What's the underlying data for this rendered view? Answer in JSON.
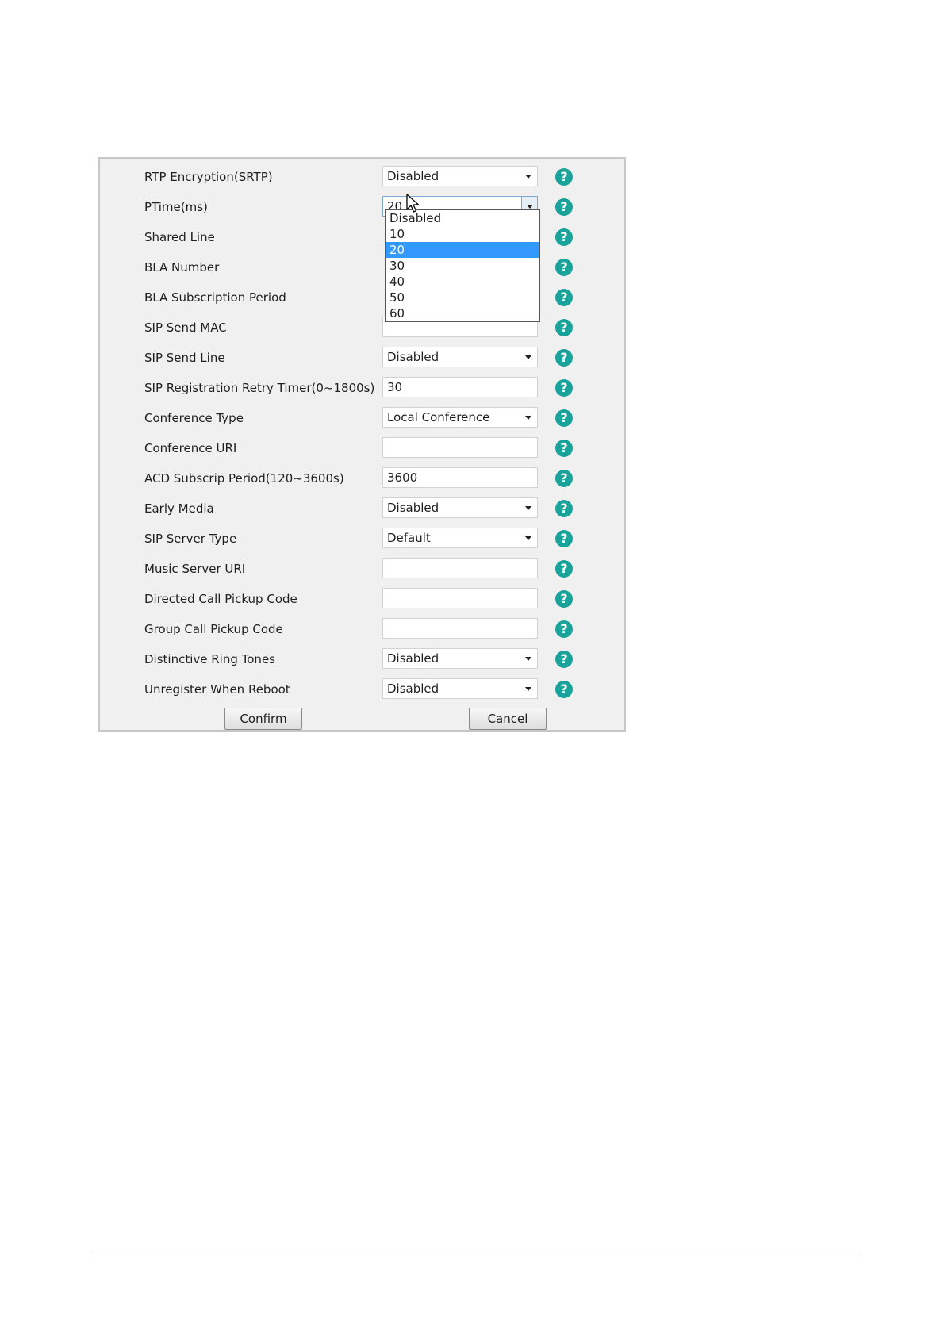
{
  "rows": [
    {
      "label": "RTP Encryption(SRTP)",
      "value": "Disabled"
    },
    {
      "label": "PTime(ms)",
      "value": "20"
    },
    {
      "label": "Shared Line",
      "value": ""
    },
    {
      "label": "BLA Number",
      "value": ""
    },
    {
      "label": "BLA Subscription Period",
      "value": ""
    },
    {
      "label": "SIP Send MAC",
      "value": ""
    },
    {
      "label": "SIP Send Line",
      "value": "Disabled"
    },
    {
      "label": "SIP Registration Retry Timer(0~1800s)",
      "value": "30"
    },
    {
      "label": "Conference Type",
      "value": "Local Conference"
    },
    {
      "label": "Conference URI",
      "value": ""
    },
    {
      "label": "ACD Subscrip Period(120~3600s)",
      "value": "3600"
    },
    {
      "label": "Early Media",
      "value": "Disabled"
    },
    {
      "label": "SIP Server Type",
      "value": "Default"
    },
    {
      "label": "Music Server URI",
      "value": ""
    },
    {
      "label": "Directed Call Pickup Code",
      "value": ""
    },
    {
      "label": "Group Call Pickup Code",
      "value": ""
    },
    {
      "label": "Distinctive Ring Tones",
      "value": "Disabled"
    },
    {
      "label": "Unregister When Reboot",
      "value": "Disabled"
    }
  ],
  "ptime_dropdown": {
    "options": [
      "Disabled",
      "10",
      "20",
      "30",
      "40",
      "50",
      "60"
    ],
    "selected": "20"
  },
  "buttons": {
    "confirm": "Confirm",
    "cancel": "Cancel"
  },
  "help_glyph": "?",
  "colors": {
    "help_icon": "#1aa39a",
    "selected_option": "#3399ff",
    "panel_bg": "#f0f0f0"
  }
}
